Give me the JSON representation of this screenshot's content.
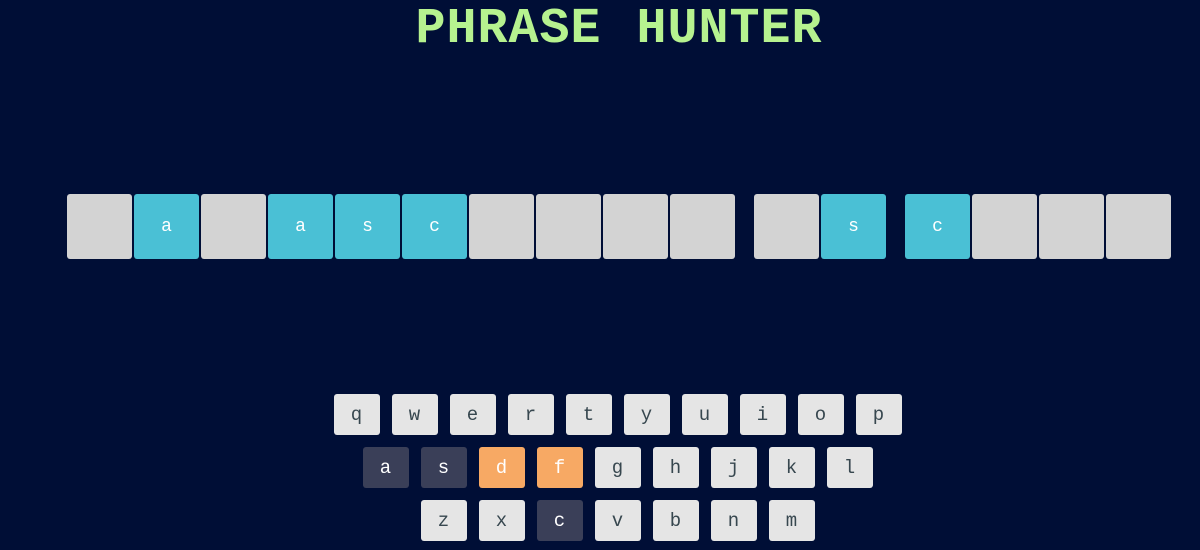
{
  "title": "PHRASE HUNTER",
  "colors": {
    "background": "#000e36",
    "title": "#b6f28f",
    "revealed_tile": "#4ac0d5",
    "hidden_tile": "#d3d3d3",
    "key_default": "#e5e5e5",
    "key_chosen": "#3a3f58",
    "key_wrong": "#f7a964"
  },
  "phrase": {
    "words": [
      [
        {
          "letter": "",
          "revealed": false
        },
        {
          "letter": "a",
          "revealed": true
        },
        {
          "letter": "",
          "revealed": false
        },
        {
          "letter": "a",
          "revealed": true
        },
        {
          "letter": "s",
          "revealed": true
        },
        {
          "letter": "c",
          "revealed": true
        },
        {
          "letter": "",
          "revealed": false
        },
        {
          "letter": "",
          "revealed": false
        },
        {
          "letter": "",
          "revealed": false
        },
        {
          "letter": "",
          "revealed": false
        }
      ],
      [
        {
          "letter": "",
          "revealed": false
        },
        {
          "letter": "s",
          "revealed": true
        }
      ],
      [
        {
          "letter": "c",
          "revealed": true
        },
        {
          "letter": "",
          "revealed": false
        },
        {
          "letter": "",
          "revealed": false
        },
        {
          "letter": "",
          "revealed": false
        }
      ]
    ]
  },
  "keyboard": {
    "rows": [
      [
        {
          "label": "q",
          "state": "default"
        },
        {
          "label": "w",
          "state": "default"
        },
        {
          "label": "e",
          "state": "default"
        },
        {
          "label": "r",
          "state": "default"
        },
        {
          "label": "t",
          "state": "default"
        },
        {
          "label": "y",
          "state": "default"
        },
        {
          "label": "u",
          "state": "default"
        },
        {
          "label": "i",
          "state": "default"
        },
        {
          "label": "o",
          "state": "default"
        },
        {
          "label": "p",
          "state": "default"
        }
      ],
      [
        {
          "label": "a",
          "state": "chosen"
        },
        {
          "label": "s",
          "state": "chosen"
        },
        {
          "label": "d",
          "state": "wrong"
        },
        {
          "label": "f",
          "state": "wrong"
        },
        {
          "label": "g",
          "state": "default"
        },
        {
          "label": "h",
          "state": "default"
        },
        {
          "label": "j",
          "state": "default"
        },
        {
          "label": "k",
          "state": "default"
        },
        {
          "label": "l",
          "state": "default"
        }
      ],
      [
        {
          "label": "z",
          "state": "default"
        },
        {
          "label": "x",
          "state": "default"
        },
        {
          "label": "c",
          "state": "chosen"
        },
        {
          "label": "v",
          "state": "default"
        },
        {
          "label": "b",
          "state": "default"
        },
        {
          "label": "n",
          "state": "default"
        },
        {
          "label": "m",
          "state": "default"
        }
      ]
    ]
  }
}
